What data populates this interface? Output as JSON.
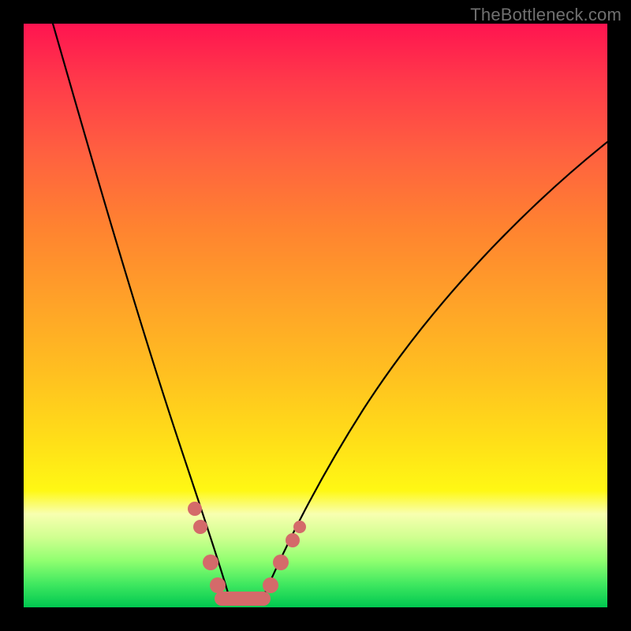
{
  "watermark": "TheBottleneck.com",
  "chart_data": {
    "type": "line",
    "title": "",
    "xlabel": "",
    "ylabel": "",
    "xlim": [
      0,
      100
    ],
    "ylim": [
      0,
      100
    ],
    "grid": false,
    "legend": false,
    "series": [
      {
        "name": "bottleneck-curve",
        "kind": "V-shaped curve (two branches)",
        "left_branch": {
          "x": [
            5,
            12,
            20,
            26,
            30,
            33,
            35
          ],
          "y": [
            100,
            78,
            52,
            30,
            14,
            4,
            0
          ]
        },
        "right_branch": {
          "x": [
            40,
            43,
            48,
            56,
            66,
            80,
            100
          ],
          "y": [
            0,
            4,
            14,
            28,
            44,
            60,
            80
          ]
        }
      }
    ],
    "markers": {
      "name": "highlighted-points",
      "color": "#d46a6a",
      "points": [
        {
          "x": 29,
          "y": 17
        },
        {
          "x": 30,
          "y": 14
        },
        {
          "x": 32,
          "y": 7
        },
        {
          "x": 33.5,
          "y": 3
        },
        {
          "x": 42,
          "y": 3
        },
        {
          "x": 44,
          "y": 7
        },
        {
          "x": 46,
          "y": 11
        },
        {
          "x": 47,
          "y": 13
        }
      ],
      "flat_segment": {
        "x_from": 34,
        "x_to": 41,
        "y": 0
      }
    },
    "colors": {
      "gradient_top": "#ff1450",
      "gradient_mid": "#ffe018",
      "gradient_bottom": "#00c850",
      "curve": "#000000",
      "marker": "#d46a6a",
      "frame": "#000000",
      "watermark": "#707070"
    }
  }
}
